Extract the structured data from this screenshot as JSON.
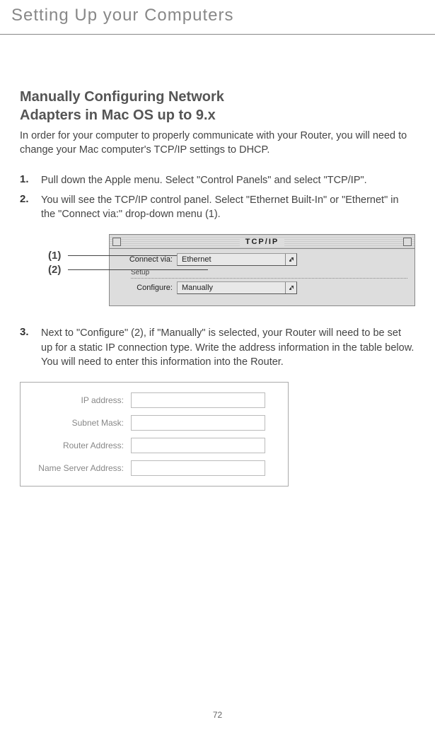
{
  "header": {
    "title": "Setting Up your Computers"
  },
  "section": {
    "heading_line1": "Manually Configuring Network",
    "heading_line2": "Adapters in Mac OS up to 9.x",
    "intro": "In order for your computer to properly communicate with your Router, you will need to change your Mac computer's TCP/IP settings to DHCP."
  },
  "steps": [
    {
      "number": "1.",
      "text": "Pull down the Apple menu. Select \"Control Panels\" and select \"TCP/IP\"."
    },
    {
      "number": "2.",
      "text": "You will see the TCP/IP control panel. Select \"Ethernet Built-In\" or \"Ethernet\" in the \"Connect via:\" drop-down menu (1)."
    },
    {
      "number": "3.",
      "text": "Next to \"Configure\" (2), if \"Manually\" is selected, your Router will need to be set up for a static IP connection type. Write the address information in the table below. You will need to enter this information into the Router."
    }
  ],
  "callouts": {
    "c1": "(1)",
    "c2": "(2)"
  },
  "tcp_panel": {
    "title": "TCP/IP",
    "connect_label": "Connect via:",
    "connect_value": "Ethernet",
    "setup_label": "Setup",
    "configure_label": "Configure:",
    "configure_value": "Manually"
  },
  "ip_table": {
    "fields": [
      {
        "label": "IP address:"
      },
      {
        "label": "Subnet Mask:"
      },
      {
        "label": "Router Address:"
      },
      {
        "label": "Name Server Address:"
      }
    ]
  },
  "page_number": "72"
}
